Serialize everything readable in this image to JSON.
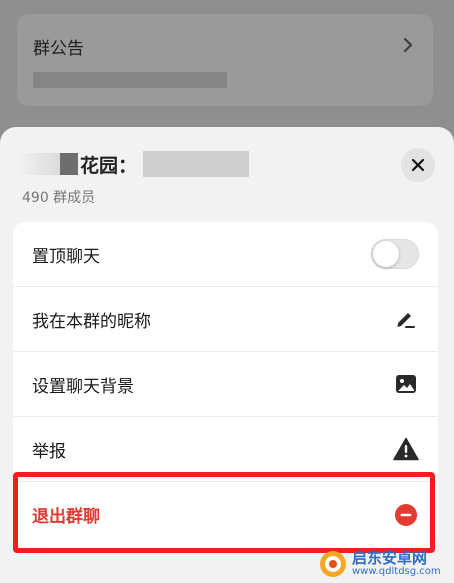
{
  "background_card": {
    "title": "群公告"
  },
  "sheet": {
    "group_name": "花园：",
    "member_count": "490 群成员"
  },
  "menu": [
    {
      "label": "置顶聊天",
      "icon": "toggle-switch",
      "toggle_on": false
    },
    {
      "label": "我在本群的昵称",
      "icon": "edit-pencil-icon"
    },
    {
      "label": "设置聊天背景",
      "icon": "image-icon"
    },
    {
      "label": "举报",
      "icon": "warning-icon"
    },
    {
      "label": "退出群聊",
      "icon": "minus-circle-icon",
      "danger": true
    }
  ],
  "watermark": {
    "main": "启东安卓网",
    "sub": "www.qdltdsg.com"
  },
  "colors": {
    "danger": "#e33b2f",
    "highlight": "#f01e1e",
    "watermark": "#2e6dc4"
  }
}
